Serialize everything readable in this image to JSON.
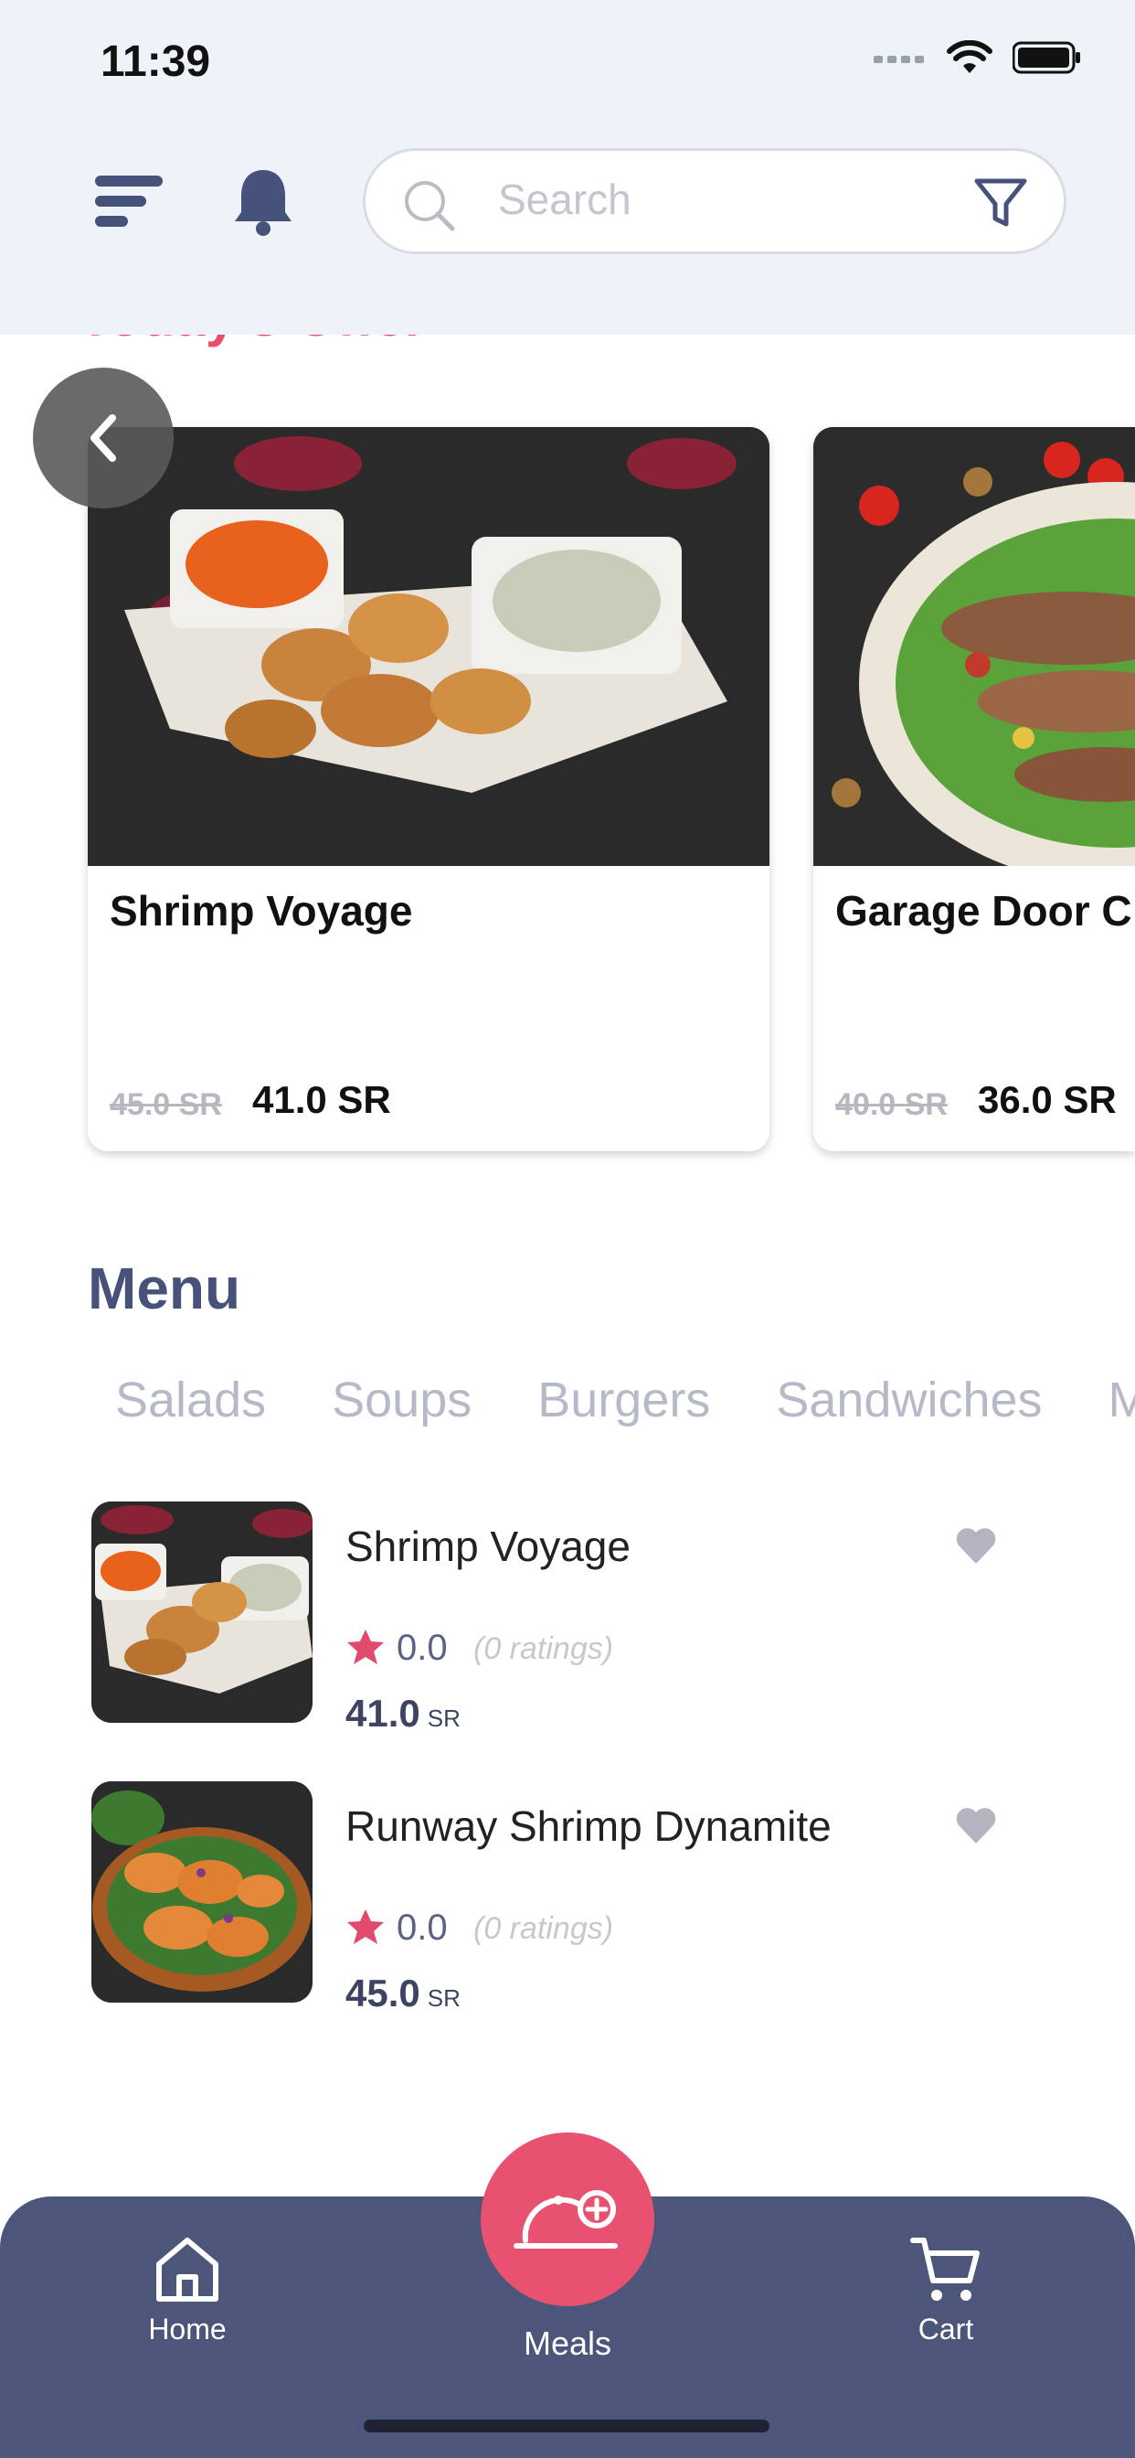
{
  "status_bar": {
    "time": "11:39"
  },
  "search": {
    "placeholder": "Search"
  },
  "offer_section": {
    "title": "Today's Offer",
    "cards": [
      {
        "name": "Shrimp Voyage",
        "old_price": "45.0 SR",
        "new_price": "41.0 SR"
      },
      {
        "name": "Garage Door C",
        "old_price": "40.0 SR",
        "new_price": "36.0 SR"
      }
    ]
  },
  "menu": {
    "title": "Menu",
    "tabs": [
      "Salads",
      "Soups",
      "Burgers",
      "Sandwiches",
      "M"
    ],
    "items": [
      {
        "name": "Shrimp Voyage",
        "rating": "0.0",
        "ratings_count": "(0 ratings)",
        "price": "41.0",
        "currency": "SR"
      },
      {
        "name": "Runway Shrimp Dynamite",
        "rating": "0.0",
        "ratings_count": "(0 ratings)",
        "price": "45.0",
        "currency": "SR"
      }
    ]
  },
  "nav": {
    "home": "Home",
    "meals": "Meals",
    "cart": "Cart"
  },
  "colors": {
    "accent": "#e8516f",
    "navy": "#4b567a",
    "header_bg": "#eef2f9"
  }
}
